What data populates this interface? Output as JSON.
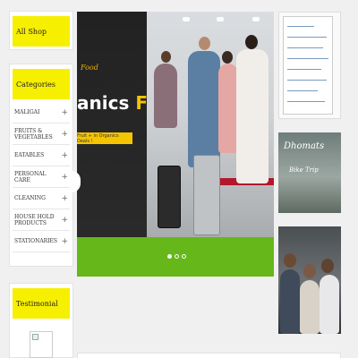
{
  "sidebar": {
    "all_shop": "All Shop",
    "categories_title": "Categories",
    "categories": [
      {
        "label": "MALIGAI"
      },
      {
        "label": "FRUITS & VEGETABLES"
      },
      {
        "label": "EATABLES"
      },
      {
        "label": "PERSONAL CARE"
      },
      {
        "label": "CLEANING"
      },
      {
        "label": "HOUSE HOLD PRODUCTS"
      },
      {
        "label": "STATIONARIES"
      }
    ],
    "expand_symbol": "+",
    "testimonial_title": "Testimonial"
  },
  "slider": {
    "tag": "Food",
    "title_white": "anics",
    "title_yellow": "Food",
    "promo": "Fruit + in Organics Deals !",
    "slides": 3,
    "active_slide": 1
  },
  "side_images": {
    "image2_script": "Dhomats",
    "image2_sub": "Bike Trip"
  },
  "colors": {
    "accent_yellow": "#f7ef00",
    "brand_green": "#66b81a",
    "title_yellow": "#f4c400"
  }
}
